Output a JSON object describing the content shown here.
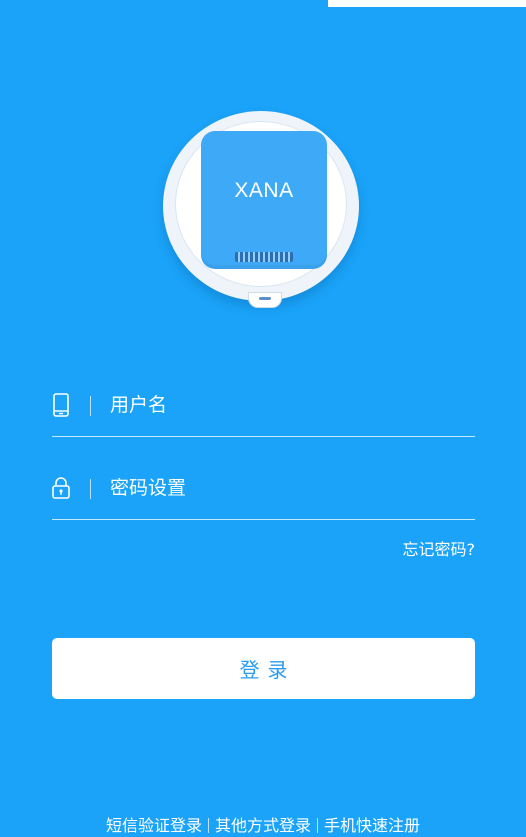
{
  "device": {
    "label": "XANA"
  },
  "form": {
    "username": {
      "placeholder": "用户名",
      "value": "",
      "icon": "phone-icon"
    },
    "password": {
      "placeholder": "密码设置",
      "value": "",
      "icon": "lock-icon"
    },
    "forgot_label": "忘记密码?"
  },
  "login": {
    "label": "登录"
  },
  "footer": {
    "links": [
      "短信验证登录",
      "其他方式登录",
      "手机快速注册"
    ]
  },
  "colors": {
    "background": "#1aa3f8",
    "button_text": "#2b9bf1",
    "button_bg": "#ffffff"
  }
}
